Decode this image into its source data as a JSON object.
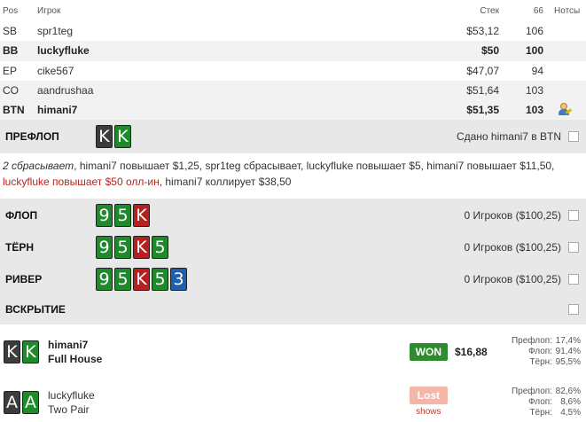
{
  "table": {
    "headers": {
      "pos": "Pos",
      "player": "Игрок",
      "stack": "Стек",
      "bb": "66",
      "notes": "Нотсы"
    },
    "rows": [
      {
        "pos": "SB",
        "name": "spr1teg",
        "stack": "$53,12",
        "bb": "106"
      },
      {
        "pos": "BB",
        "name": "luckyfluke",
        "stack": "$50",
        "bb": "100"
      },
      {
        "pos": "EP",
        "name": "cike567",
        "stack": "$47,07",
        "bb": "94"
      },
      {
        "pos": "CO",
        "name": "aandrushaa",
        "stack": "$51,64",
        "bb": "103"
      },
      {
        "pos": "BTN",
        "name": "himani7",
        "stack": "$51,35",
        "bb": "103",
        "note_icon": "user-note-icon"
      }
    ]
  },
  "preflop": {
    "label": "ПРЕФЛОП",
    "cards": [
      {
        "rank": "K",
        "suit": "spades"
      },
      {
        "rank": "K",
        "suit": "clubs"
      }
    ],
    "dealt_text": "Сдано himani7 в BTN",
    "actions": [
      {
        "text": "2 сбрасывает",
        "style": "italic"
      },
      {
        "text": ", himani7 повышает $1,25, spr1teg сбрасывает, luckyfluke повышает $5, himani7 повышает $11,50,",
        "style": "normal"
      },
      {
        "text": "luckyfluke повышает $50 олл-ин",
        "style": "red"
      },
      {
        "text": ", himani7 коллирует $38,50",
        "style": "normal"
      }
    ]
  },
  "flop": {
    "label": "ФЛОП",
    "cards": [
      {
        "rank": "9",
        "suit": "clubs"
      },
      {
        "rank": "5",
        "suit": "clubs"
      },
      {
        "rank": "K",
        "suit": "hearts"
      }
    ],
    "info": "0 Игроков ($100,25)"
  },
  "turn": {
    "label": "ТЁРН",
    "cards": [
      {
        "rank": "9",
        "suit": "clubs"
      },
      {
        "rank": "5",
        "suit": "clubs"
      },
      {
        "rank": "K",
        "suit": "hearts"
      },
      {
        "rank": "5",
        "suit": "clubs"
      }
    ],
    "info": "0 Игроков ($100,25)"
  },
  "river": {
    "label": "РИВЕР",
    "cards": [
      {
        "rank": "9",
        "suit": "clubs"
      },
      {
        "rank": "5",
        "suit": "clubs"
      },
      {
        "rank": "K",
        "suit": "hearts"
      },
      {
        "rank": "5",
        "suit": "clubs"
      },
      {
        "rank": "3",
        "suit": "diamonds"
      }
    ],
    "info": "0 Игроков ($100,25)"
  },
  "showdown": {
    "label": "ВСКРЫТИЕ"
  },
  "results": [
    {
      "name": "himani7",
      "hand_desc": "Full House",
      "cards": [
        {
          "rank": "K",
          "suit": "spades"
        },
        {
          "rank": "K",
          "suit": "clubs"
        }
      ],
      "badge": "WON",
      "amount": "$16,88",
      "equity": [
        {
          "label": "Префлоп:",
          "value": "17,4%"
        },
        {
          "label": "Флоп:",
          "value": "91,4%"
        },
        {
          "label": "Тёрн:",
          "value": "95,5%"
        }
      ]
    },
    {
      "name": "luckyfluke",
      "hand_desc": "Two Pair",
      "cards": [
        {
          "rank": "A",
          "suit": "spades"
        },
        {
          "rank": "A",
          "suit": "clubs"
        }
      ],
      "badge": "Lost",
      "badge_sub": "shows",
      "equity": [
        {
          "label": "Префлоп:",
          "value": "82,6%"
        },
        {
          "label": "Флоп:",
          "value": "8,6%"
        },
        {
          "label": "Тёрн:",
          "value": "4,5%"
        }
      ]
    }
  ],
  "colors": {
    "spades": "#3c3c3c",
    "clubs": "#1f8a2c",
    "hearts": "#b91f1f",
    "diamonds": "#1f5fb0",
    "won": "#2e8b2e",
    "lost": "#f3b6a8",
    "allin": "#b3261e"
  }
}
